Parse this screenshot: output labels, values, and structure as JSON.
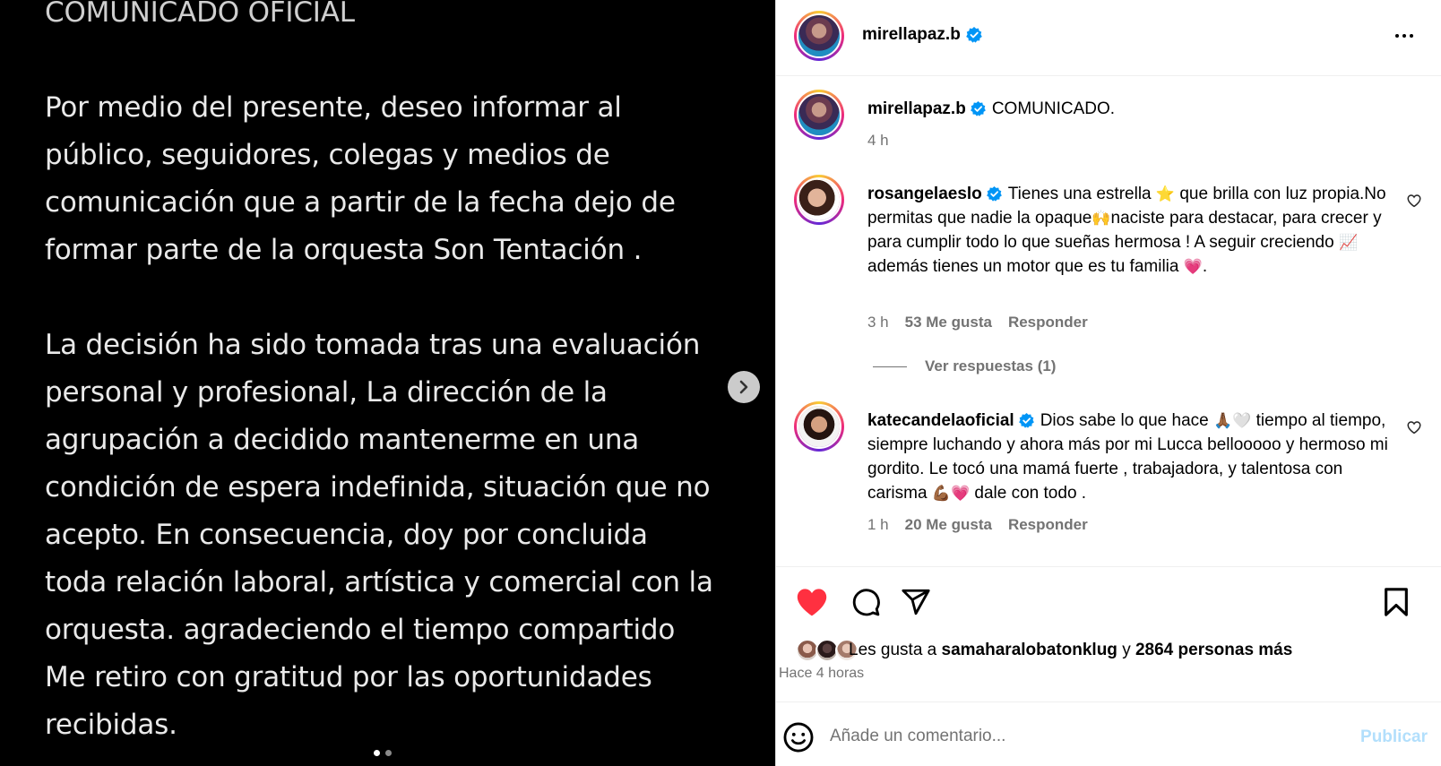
{
  "post": {
    "heading": "COMUNICADO OFICIAL",
    "paragraph1": [
      "Por medio del presente, deseo informar al",
      "público, seguidores, colegas y medios de",
      "comunicación que a partir de la fecha dejo de",
      "formar parte de la orquesta Son Tentación ."
    ],
    "paragraph2": [
      "La decisión ha sido tomada tras una evaluación",
      "personal y profesional, La dirección de la",
      "agrupación a decidido mantenerme en una",
      "condición de espera indefinida, situación que no",
      "acepto. En consecuencia, doy por concluida",
      "toda relación laboral, artística y comercial con la",
      "orquesta. agradeciendo el tiempo compartido",
      "Me retiro con gratitud por las oportunidades",
      "recibidas."
    ],
    "carousel_pages": 2,
    "carousel_current": 1
  },
  "header": {
    "username": "mirellapaz.b"
  },
  "caption": {
    "username": "mirellapaz.b",
    "text": "COMUNICADO.",
    "time": "4 h"
  },
  "comments": [
    {
      "username": "rosangelaeslo",
      "text_parts": [
        "Tienes una estrella ",
        "⭐",
        " que brilla con luz propia.No permitas que nadie la opaque",
        "🙌",
        "naciste para destacar, para crecer y para cumplir todo lo que sueñas hermosa ! A seguir creciendo ",
        "📈",
        " además tienes un motor que es tu familia ",
        "💗",
        "."
      ],
      "time": "3 h",
      "likes": "53 Me gusta",
      "reply": "Responder",
      "view_replies": "Ver respuestas (1)"
    },
    {
      "username": "katecandelaoficial",
      "text_parts": [
        "Dios sabe lo que hace ",
        "🙏🏾",
        "🤍",
        " tiempo al tiempo, siempre luchando y ahora más por mi Lucca bellooooo y hermoso mi gordito. Le tocó una mamá fuerte , trabajadora, y talentosa con carisma ",
        "💪🏾",
        "💗",
        " dale con todo ."
      ],
      "time": "1 h",
      "likes": "20 Me gusta",
      "reply": "Responder"
    }
  ],
  "likes": {
    "prefix": "Les gusta a ",
    "user": "samaharalobatonklug",
    "middle": " y ",
    "others": "2864 personas más",
    "timestamp": "Hace 4 horas"
  },
  "composer": {
    "placeholder": "Añade un comentario...",
    "publish": "Publicar"
  },
  "colors": {
    "like_red": "#ff3040",
    "verified_blue": "#0095f6",
    "publish_disabled": "#b2dffc",
    "muted": "#737373"
  },
  "icons": [
    "heart-icon",
    "comment-icon",
    "share-icon",
    "bookmark-icon",
    "more-icon",
    "emoji-icon",
    "chevron-right-icon",
    "verified-icon"
  ]
}
